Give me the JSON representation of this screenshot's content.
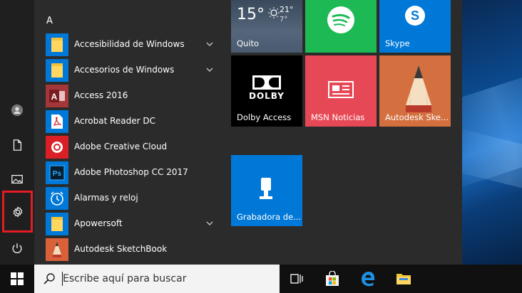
{
  "applist": {
    "letter": "A",
    "items": [
      {
        "label": "Accesibilidad de Windows",
        "icon": "folder-icon",
        "expandable": true
      },
      {
        "label": "Accesorios de Windows",
        "icon": "folder-icon",
        "expandable": true
      },
      {
        "label": "Access 2016",
        "icon": "access-icon",
        "expandable": false
      },
      {
        "label": "Acrobat Reader DC",
        "icon": "acrobat-icon",
        "expandable": false
      },
      {
        "label": "Adobe Creative Cloud",
        "icon": "creative-cloud-icon",
        "expandable": false
      },
      {
        "label": "Adobe Photoshop CC 2017",
        "icon": "photoshop-icon",
        "expandable": false
      },
      {
        "label": "Alarmas y reloj",
        "icon": "alarm-clock-icon",
        "expandable": false
      },
      {
        "label": "Apowersoft",
        "icon": "folder-icon",
        "expandable": true
      },
      {
        "label": "Autodesk SketchBook",
        "icon": "sketchbook-icon",
        "expandable": false
      }
    ]
  },
  "tiles": {
    "weather": {
      "temp": "15°",
      "high": "21°",
      "low": "7°",
      "city": "Quito"
    },
    "spotify": {
      "label": ""
    },
    "skype": {
      "label": "Skype"
    },
    "dolby": {
      "logo_text": "DOLBY",
      "label": "Dolby Access"
    },
    "msn": {
      "label": "MSN Noticias"
    },
    "sketch": {
      "label": "Autodesk Ske..."
    },
    "recorder": {
      "label": "Grabadora de..."
    }
  },
  "search": {
    "placeholder": "Escribe aquí para buscar"
  },
  "colors": {
    "accent": "#0078d7",
    "msn": "#e74856",
    "spotify": "#1db954",
    "highlight": "#e31b23"
  }
}
